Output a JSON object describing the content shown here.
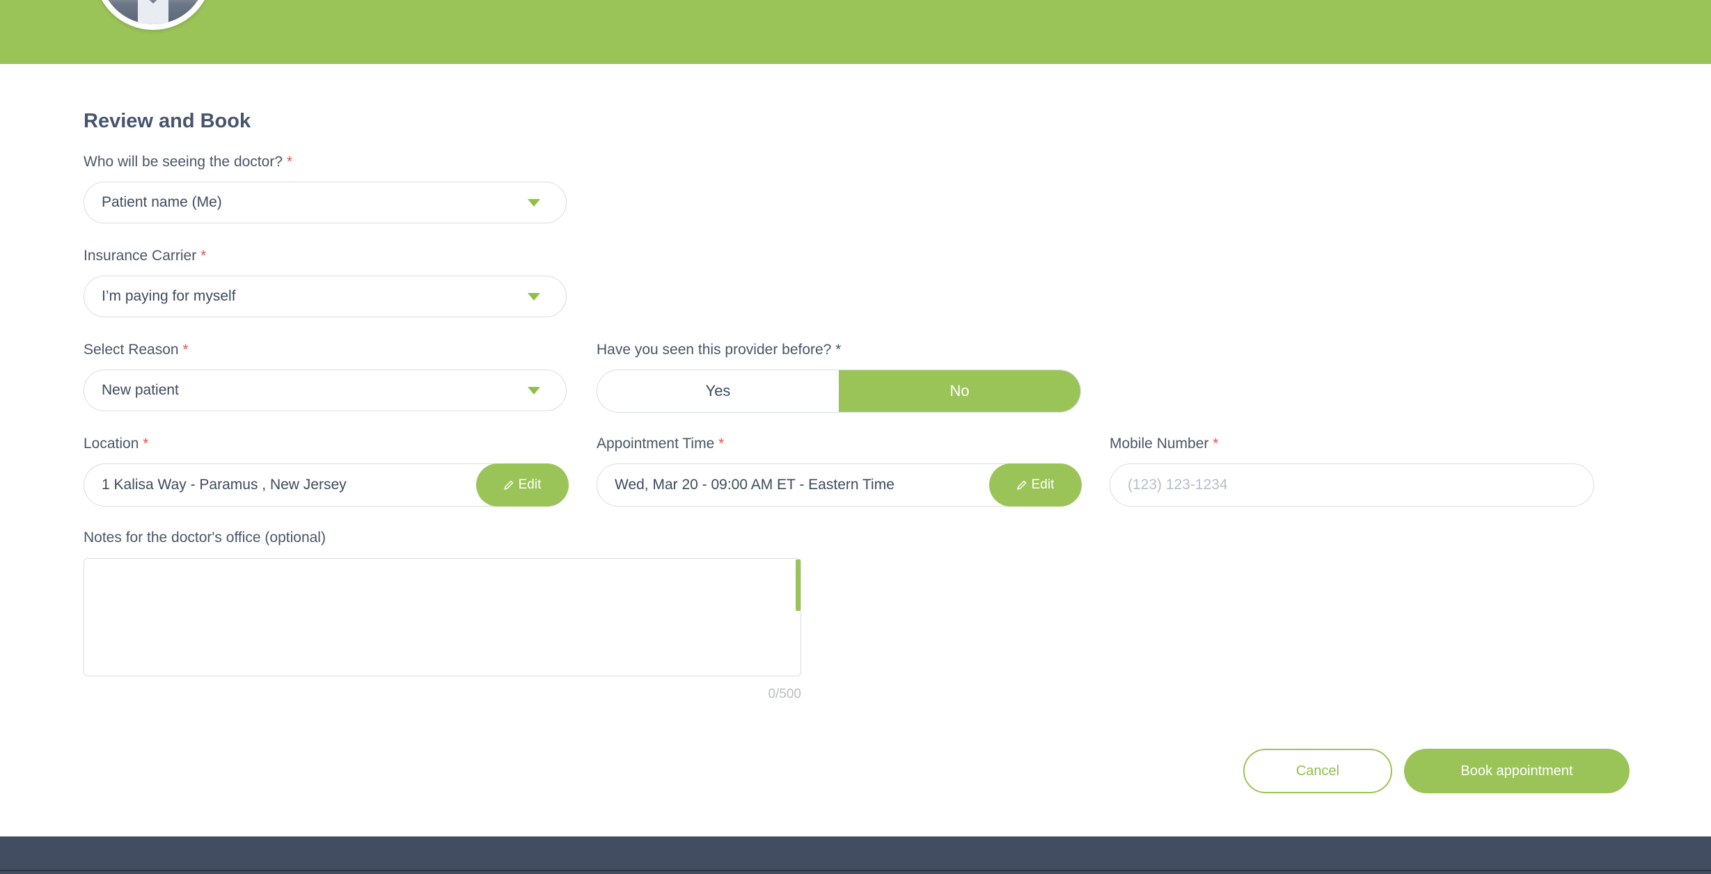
{
  "page": {
    "title": "Review and Book"
  },
  "patient": {
    "label": "Who will be seeing the doctor?",
    "required_mark": "*",
    "value": "Patient name (Me)"
  },
  "insurance": {
    "label": "Insurance Carrier",
    "required_mark": "*",
    "value": "I’m paying for myself"
  },
  "reason": {
    "label": "Select Reason",
    "required_mark": "*",
    "value": "New patient"
  },
  "seen_before": {
    "label": "Have you seen this provider before?",
    "required_mark": "*",
    "options": [
      "Yes",
      "No"
    ],
    "selected": "No"
  },
  "location": {
    "label": "Location",
    "required_mark": "*",
    "value": "1 Kalisa Way - Paramus , New Jersey",
    "edit_label": "Edit"
  },
  "appointment_time": {
    "label": "Appointment Time",
    "required_mark": "*",
    "value": "Wed, Mar 20 - 09:00 AM ET - Eastern Time",
    "edit_label": "Edit"
  },
  "mobile": {
    "label": "Mobile Number",
    "required_mark": "*",
    "placeholder": "(123) 123-1234",
    "value": ""
  },
  "notes": {
    "label": "Notes for the doctor's office (optional)",
    "value": "",
    "counter": "0/500"
  },
  "actions": {
    "cancel_label": "Cancel",
    "book_label": "Book appointment"
  },
  "colors": {
    "accent": "#9bc458",
    "required": "#e05757",
    "footer": "#434d62",
    "text": "#4a5568"
  }
}
